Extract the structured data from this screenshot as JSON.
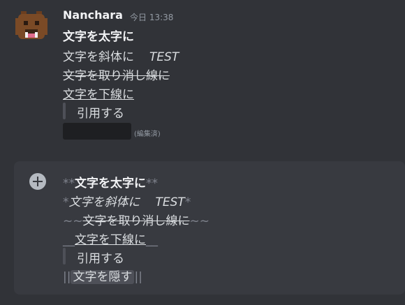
{
  "message": {
    "username": "Nanchara",
    "timestamp": "今日 13:38",
    "bold_text": "文字を太字に",
    "italic_prefix": "文字を斜体に",
    "italic_word": "TEST",
    "strike_text": "文字を取り消し線に",
    "underline_text": "文字を下線に",
    "quote_text": "引用する",
    "edited_label": "(編集済)"
  },
  "composer": {
    "bold_marker": "**",
    "bold_text": "文字を太字に",
    "italic_marker": "*",
    "italic_prefix": "文字を斜体に",
    "italic_word": "TEST",
    "strike_marker": "~~",
    "strike_text": "文字を取り消し線に",
    "underline_marker": "__",
    "underline_text": "文字を下線に",
    "quote_text": "引用する",
    "spoiler_marker": "||",
    "spoiler_text": "文字を隠す"
  },
  "colors": {
    "background": "#313338",
    "composer_bg": "#383a40",
    "spoiler_bg": "#1e1f22",
    "markdown_syntax": "#80848e"
  },
  "icons": {
    "avatar": "pixel-bear-avatar",
    "attach": "plus-circle-icon"
  }
}
